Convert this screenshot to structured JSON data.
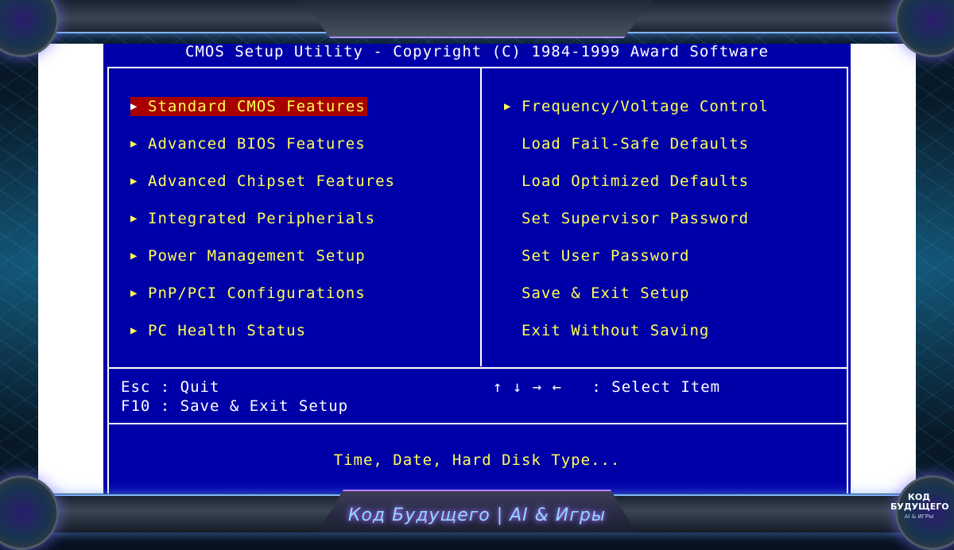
{
  "bios": {
    "title": "CMOS Setup Utility - Copyright (C) 1984-1999 Award Software",
    "left_menu": [
      {
        "label": "Standard CMOS Features",
        "selected": true
      },
      {
        "label": "Advanced BIOS Features"
      },
      {
        "label": "Advanced Chipset Features"
      },
      {
        "label": "Integrated Peripherials"
      },
      {
        "label": "Power Management Setup"
      },
      {
        "label": "PnP/PCI Configurations"
      },
      {
        "label": "PC Health Status"
      }
    ],
    "right_menu": [
      {
        "label": "Frequency/Voltage Control",
        "submenu": true
      },
      {
        "label": "Load Fail-Safe Defaults"
      },
      {
        "label": "Load Optimized Defaults"
      },
      {
        "label": "Set Supervisor Password"
      },
      {
        "label": "Set User Password"
      },
      {
        "label": "Save & Exit Setup"
      },
      {
        "label": "Exit Without Saving"
      }
    ],
    "help": {
      "esc": "Esc : Quit",
      "f10": "F10 : Save & Exit Setup",
      "nav": "↑ ↓ → ←   : Select Item"
    },
    "description": "Time, Date, Hard Disk Type..."
  },
  "overlay": {
    "channel_banner": "Код Будущего | AI & Игры",
    "corner_brand_line1": "КОД",
    "corner_brand_line2": "БУДУЩЕГО",
    "corner_brand_line3": "AI & ИГРЫ"
  },
  "colors": {
    "bios_background": "#0000a8",
    "menu_text": "#ffff55",
    "selected_highlight": "#a80000",
    "border": "#ffffff"
  }
}
